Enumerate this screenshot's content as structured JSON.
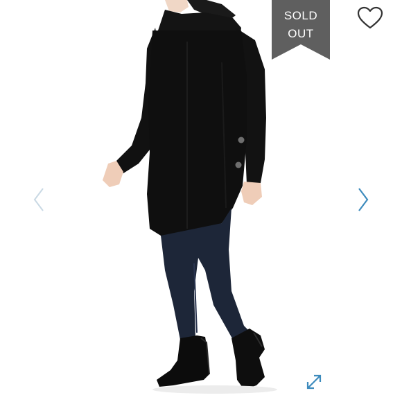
{
  "listing": {
    "badge": {
      "line1": "SOLD",
      "line2": "OUT",
      "color": "#5f5f5f"
    },
    "icons": {
      "favorite": "heart-outline-icon",
      "previous": "chevron-left-icon",
      "next": "chevron-right-icon",
      "expand": "expand-arrows-icon"
    },
    "colors": {
      "accent": "#3d8bbd",
      "prev_arrow": "#c9d9e4",
      "heart": "#333333"
    }
  }
}
